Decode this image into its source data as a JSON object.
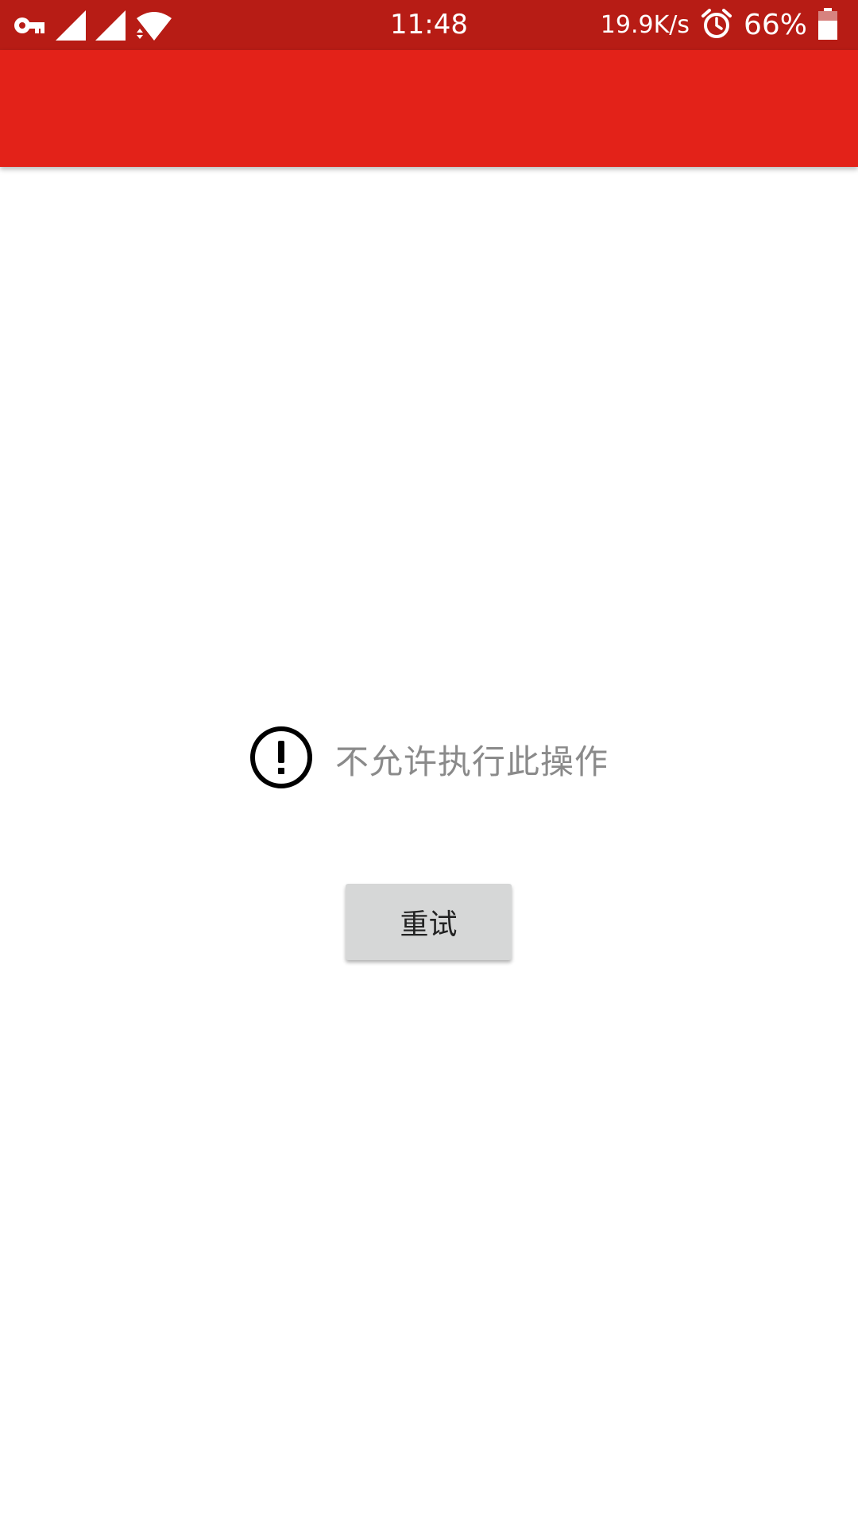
{
  "status_bar": {
    "icons_left": [
      "vpn-key-icon",
      "signal-icon",
      "signal-icon",
      "wifi-icon"
    ],
    "time": "11:48",
    "net_speed": "19.9K/s",
    "alarm_icon": "alarm-icon",
    "battery_percent": "66%",
    "battery_level": 0.66,
    "background_color": "#b71c15"
  },
  "app_bar": {
    "background_color": "#e32219"
  },
  "error": {
    "icon": "exclamation-circle-icon",
    "message": "不允许执行此操作"
  },
  "retry_button": {
    "label": "重试"
  }
}
